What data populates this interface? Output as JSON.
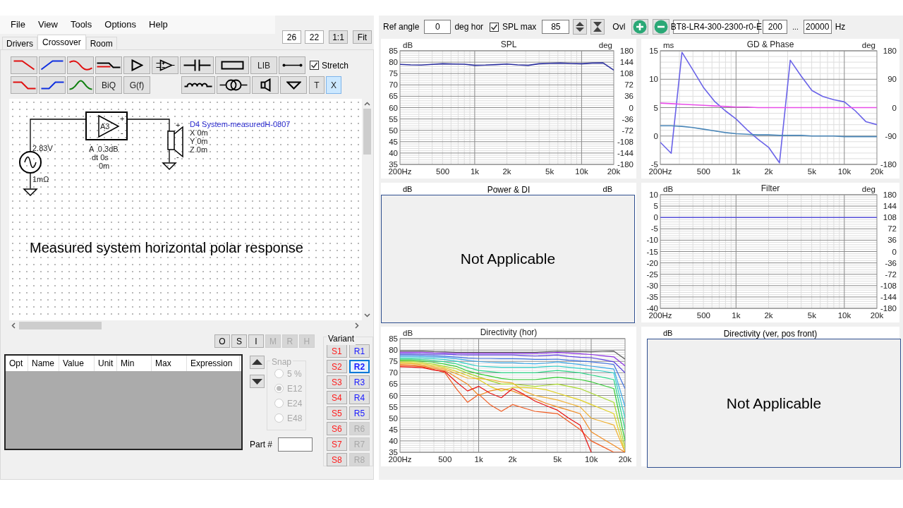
{
  "menu": [
    "File",
    "View",
    "Tools",
    "Options",
    "Help"
  ],
  "zoom_fields": [
    "26",
    "22"
  ],
  "view_buttons": [
    "1:1",
    "Fit"
  ],
  "tabs": [
    {
      "label": "Drivers",
      "selected": false
    },
    {
      "label": "Crossover",
      "selected": true
    },
    {
      "label": "Room",
      "selected": false
    }
  ],
  "toolbar_rows": [
    [
      {
        "kind": "lowpass",
        "selected": false
      },
      {
        "kind": "highpass",
        "selected": false
      },
      {
        "kind": "curve",
        "selected": false
      },
      {
        "kind": "step",
        "selected": false
      },
      {
        "kind": "buffer",
        "selected": false
      },
      {
        "kind": "opamp",
        "selected": false
      },
      {
        "kind": "capacitor",
        "selected": false
      },
      {
        "kind": "resistor",
        "selected": false
      },
      {
        "kind": "text",
        "label": "LIB",
        "selected": false
      },
      {
        "kind": "wire",
        "selected": false
      }
    ],
    [
      {
        "kind": "lowpass2",
        "selected": false
      },
      {
        "kind": "highpass2",
        "selected": false
      },
      {
        "kind": "bandpass",
        "selected": false
      },
      {
        "kind": "text",
        "label": "BiQ",
        "selected": false
      },
      {
        "kind": "text",
        "label": "G(f)",
        "selected": false
      },
      {
        "kind": "inductor",
        "selected": false
      },
      {
        "kind": "transformer",
        "selected": false
      },
      {
        "kind": "speaker",
        "selected": false
      },
      {
        "kind": "ground",
        "selected": false
      },
      {
        "kind": "small",
        "label": "T",
        "selected": false
      },
      {
        "kind": "small",
        "label": "X",
        "selected": true
      }
    ]
  ],
  "stretch": {
    "label": "Stretch",
    "checked": true
  },
  "schematic": {
    "source_voltage": "2.83V",
    "source_resistance": "1mΩ",
    "amp_label": "A3",
    "amp_plus": "+",
    "amp_minus": "-",
    "amp_gain": "A  0.3dB",
    "amp_delay": "dt 0s",
    "amp_offset": "0m",
    "driver_name": "D4 System-measuredH-0807",
    "driver_x": "X 0m",
    "driver_y": "Y 0m",
    "driver_z": "Z 0m",
    "driver_plus": "+",
    "driver_minus": "-"
  },
  "caption": "Measured system horizontal polar response",
  "part_buttons": [
    {
      "label": "O",
      "disabled": false
    },
    {
      "label": "S",
      "disabled": false
    },
    {
      "label": "I",
      "disabled": false
    },
    {
      "label": "M",
      "disabled": true
    },
    {
      "label": "R",
      "disabled": true
    },
    {
      "label": "H",
      "disabled": true
    }
  ],
  "parameter_table": {
    "columns": [
      "Opt",
      "Name",
      "Value",
      "Unit",
      "Min",
      "Max",
      "Expression"
    ]
  },
  "snap": {
    "title": "Snap",
    "disabled": true,
    "options": [
      {
        "label": "5 %",
        "selected": false
      },
      {
        "label": "E12",
        "selected": true
      },
      {
        "label": "E24",
        "selected": false
      },
      {
        "label": "E48",
        "selected": false
      }
    ]
  },
  "part_number": {
    "label": "Part #"
  },
  "variant": {
    "title": "Variant",
    "s": [
      {
        "label": "S1",
        "selected": false,
        "disabled": false
      },
      {
        "label": "S2",
        "selected": false,
        "disabled": false
      },
      {
        "label": "S3",
        "selected": false,
        "disabled": false
      },
      {
        "label": "S4",
        "selected": false,
        "disabled": false
      },
      {
        "label": "S5",
        "selected": false,
        "disabled": false
      },
      {
        "label": "S6",
        "selected": false,
        "disabled": false
      },
      {
        "label": "S7",
        "selected": false,
        "disabled": false
      },
      {
        "label": "S8",
        "selected": false,
        "disabled": false
      }
    ],
    "r": [
      {
        "label": "R1",
        "selected": false,
        "disabled": false
      },
      {
        "label": "R2",
        "selected": true,
        "disabled": false
      },
      {
        "label": "R3",
        "selected": false,
        "disabled": false
      },
      {
        "label": "R4",
        "selected": false,
        "disabled": false
      },
      {
        "label": "R5",
        "selected": false,
        "disabled": false
      },
      {
        "label": "R6",
        "selected": false,
        "disabled": true
      },
      {
        "label": "R7",
        "selected": false,
        "disabled": true
      },
      {
        "label": "R8",
        "selected": false,
        "disabled": true
      }
    ]
  },
  "top_bar": {
    "ref_angle_label": "Ref angle",
    "ref_angle": "0",
    "ref_angle_unit": "deg hor",
    "spl_max": {
      "label": "SPL max",
      "checked": true
    },
    "spl_max_value": "85",
    "overlay_label": "Ovl",
    "overlay_name": "BT8-LR4-300-2300-r0-E",
    "freq_from": "200",
    "range_separator": "...",
    "freq_to": "20000",
    "freq_unit": "Hz"
  },
  "charts": [
    {
      "kind": "chart",
      "chart_data": {
        "type": "line",
        "grid": true,
        "title": "SPL",
        "ylabel": "dB",
        "y2label": "deg",
        "ylim": [
          35,
          85
        ],
        "y2lim": [
          -180,
          180
        ],
        "categories": [
          "200Hz",
          null,
          null,
          null,
          "500",
          null,
          null,
          "1k",
          null,
          null,
          "2k",
          null,
          null,
          null,
          "5k",
          null,
          null,
          "10k",
          null,
          null,
          "20k"
        ],
        "yticks": [
          35,
          40,
          45,
          50,
          55,
          60,
          65,
          70,
          75,
          80,
          85
        ],
        "y2ticks": [
          -180,
          -144,
          -108,
          -72,
          -36,
          0,
          36,
          72,
          108,
          144,
          180
        ],
        "series": [
          {
            "color": "#2b2f9e",
            "values": [
              79,
              78.8,
              78.7,
              79,
              79.3,
              79.2,
              79.1,
              78.6,
              78.7,
              78.9,
              79.2,
              78.8,
              78.6,
              79.3,
              79.5,
              79.6,
              79.4,
              79.3,
              79.6,
              79.7,
              76.5
            ]
          }
        ]
      }
    },
    {
      "kind": "chart",
      "chart_data": {
        "type": "line",
        "grid": true,
        "title": "GD & Phase",
        "ylabel": "ms",
        "y2label": "deg",
        "ylim": [
          -5,
          15
        ],
        "y2lim": [
          -180,
          180
        ],
        "categories": [
          "200Hz",
          null,
          null,
          null,
          "500",
          null,
          null,
          "1k",
          null,
          null,
          "2k",
          null,
          null,
          null,
          "5k",
          null,
          null,
          "10k",
          null,
          null,
          "20k"
        ],
        "yticks": [
          -5,
          0,
          5,
          10,
          15
        ],
        "y2ticks": [
          -180,
          -90,
          0,
          90,
          180
        ],
        "series": [
          {
            "color": "#6a63e8",
            "axis": "y2",
            "values": [
              -110,
              -145,
              175,
              120,
              63,
              20,
              -10,
              -36,
              -70,
              -100,
              -126,
              -175,
              150,
              100,
              54,
              35,
              25,
              18,
              -10,
              -45,
              -54
            ]
          },
          {
            "color": "#e84ee8",
            "values": [
              5.8,
              5.7,
              5.6,
              5.5,
              5.4,
              5.3,
              5.2,
              5.1,
              5.1,
              5,
              5,
              5,
              5,
              5,
              5,
              5,
              5,
              5,
              5,
              5,
              5
            ]
          },
          {
            "color": "#4a86b8",
            "values": [
              1.8,
              1.8,
              1.7,
              1.5,
              1.2,
              0.9,
              0.6,
              0.4,
              0.3,
              0.2,
              0.2,
              0.1,
              0.1,
              0.1,
              0,
              0,
              0,
              -0.1,
              -0.1,
              -0.1,
              -0.1
            ]
          }
        ]
      }
    },
    {
      "kind": "overlay",
      "title": "Power & DI",
      "left_unit": "dB",
      "right_unit": "dB",
      "overlay_text": "Not Applicable"
    },
    {
      "kind": "chart",
      "chart_data": {
        "type": "line",
        "grid": true,
        "title": "Filter",
        "ylabel": "dB",
        "y2label": "deg",
        "ylim": [
          -40,
          10
        ],
        "y2lim": [
          -180,
          180
        ],
        "categories": [
          "200Hz",
          null,
          null,
          null,
          "500",
          null,
          null,
          "1k",
          null,
          null,
          "2k",
          null,
          null,
          null,
          "5k",
          null,
          null,
          "10k",
          null,
          null,
          "20k"
        ],
        "yticks": [
          -40,
          -35,
          -30,
          -25,
          -20,
          -15,
          -10,
          -5,
          0,
          5,
          10
        ],
        "y2ticks": [
          -180,
          -144,
          -108,
          -72,
          -36,
          0,
          36,
          72,
          108,
          144,
          180
        ],
        "series": [
          {
            "color": "#5a55e0",
            "values": [
              0,
              0,
              0,
              0,
              0,
              0,
              0,
              0,
              0,
              0,
              0,
              0,
              0,
              0,
              0,
              0,
              0,
              0,
              0,
              0,
              0
            ]
          }
        ]
      }
    },
    {
      "kind": "chart",
      "chart_data": {
        "type": "line",
        "grid": true,
        "title": "Directivity (hor)",
        "ylabel": "dB",
        "ylim": [
          35,
          85
        ],
        "categories": [
          "200Hz",
          null,
          null,
          null,
          "500",
          null,
          null,
          "1k",
          null,
          null,
          "2k",
          null,
          null,
          null,
          "5k",
          null,
          null,
          "10k",
          null,
          null,
          "20k"
        ],
        "yticks": [
          35,
          40,
          45,
          50,
          55,
          60,
          65,
          70,
          75,
          80,
          85
        ],
        "series": [
          {
            "color": "#555555",
            "values": [
              79.5,
              79.5,
              79.5,
              79.3,
              79.2,
              79,
              79,
              79,
              79,
              79,
              79,
              79,
              79,
              79.2,
              79.4,
              79.3,
              79.3,
              79.2,
              79.4,
              79.5,
              76
            ]
          },
          {
            "color": "#8a2be2",
            "values": [
              79,
              79,
              79,
              78.8,
              78.7,
              78.5,
              78.5,
              78.5,
              78.5,
              78.5,
              78.5,
              78.5,
              78.5,
              78.7,
              78.9,
              78.7,
              78.4,
              78,
              77.5,
              77,
              73
            ]
          },
          {
            "color": "#5b3fe0",
            "values": [
              78.4,
              78.4,
              78.3,
              78.2,
              78.1,
              77.9,
              77.8,
              77.8,
              77.8,
              77.8,
              77.8,
              77.6,
              77.4,
              77.6,
              77.8,
              77.2,
              76.8,
              76.6,
              75.8,
              74.8,
              70
            ]
          },
          {
            "color": "#3c6ee0",
            "values": [
              77.8,
              77.8,
              77.7,
              77.5,
              77.3,
              76.9,
              76.5,
              76.3,
              76.3,
              76.2,
              76.2,
              76.1,
              75.9,
              75.9,
              76,
              75.5,
              75.2,
              74.8,
              74.3,
              73.6,
              63
            ]
          },
          {
            "color": "#3aa8e8",
            "values": [
              77.2,
              77.2,
              77.1,
              76.9,
              76.7,
              76.2,
              75.5,
              74.9,
              74.6,
              74.4,
              74.4,
              74.1,
              73.9,
              74.3,
              74.8,
              74.2,
              73.6,
              72.9,
              72.3,
              71.6,
              55
            ]
          },
          {
            "color": "#30d0c8",
            "values": [
              76.6,
              76.6,
              76.5,
              76.2,
              75.8,
              75.1,
              73.9,
              72.9,
              72.6,
              72.4,
              72.4,
              72.4,
              72.4,
              72.7,
              72.9,
              72.4,
              71.9,
              71.4,
              70.7,
              69.9,
              50
            ]
          },
          {
            "color": "#2ed88a",
            "values": [
              76.1,
              76.1,
              75.8,
              75.3,
              74.8,
              73.9,
              72.4,
              71,
              70.5,
              70,
              70,
              70,
              70,
              70.5,
              71,
              70.5,
              70,
              69,
              68,
              67,
              45
            ]
          },
          {
            "color": "#33cc33",
            "values": [
              75.6,
              75.6,
              75.2,
              74.6,
              73.8,
              72.8,
              70.8,
              69.5,
              68.5,
              67.5,
              67,
              67,
              67,
              67.5,
              68,
              67.5,
              67,
              66,
              64.5,
              63,
              40
            ]
          },
          {
            "color": "#a8d82a",
            "values": [
              75.1,
              75,
              74.6,
              73.8,
              72.8,
              71.8,
              69.8,
              68.2,
              66.5,
              65,
              65,
              64.5,
              64,
              64.5,
              65,
              64,
              63,
              61,
              59,
              57,
              37
            ]
          },
          {
            "color": "#e0d020",
            "values": [
              74.6,
              74.5,
              74,
              73.2,
              72.2,
              70.6,
              68.8,
              67,
              64,
              62,
              63.5,
              63.5,
              63.2,
              62.5,
              61,
              59.5,
              58,
              56,
              54,
              52,
              35
            ]
          },
          {
            "color": "#f0b030",
            "values": [
              74.1,
              74,
              73.5,
              72.6,
              71.6,
              69.6,
              67.6,
              67.5,
              67,
              66,
              65.5,
              62,
              60,
              59,
              58,
              56.5,
              55,
              50,
              48.5,
              47,
              35
            ]
          },
          {
            "color": "#f08a20",
            "values": [
              73.6,
              73.5,
              73,
              72,
              71,
              68,
              65,
              60,
              62,
              63,
              62,
              60,
              58.5,
              56.5,
              55,
              53.5,
              52,
              44,
              41,
              38,
              35
            ]
          },
          {
            "color": "#f05a20",
            "values": [
              73.1,
              73,
              72.6,
              71.5,
              70,
              63,
              57,
              60.5,
              56,
              53,
              56,
              54.5,
              53,
              52.5,
              52,
              48.5,
              45,
              40,
              37.5,
              35,
              35
            ]
          },
          {
            "color": "#e81010",
            "values": [
              72.6,
              72.5,
              72.2,
              71.2,
              70.5,
              66,
              62,
              64,
              61,
              59,
              63,
              60.5,
              57.5,
              55.5,
              53.5,
              50,
              47,
              35,
              null,
              null,
              null
            ]
          }
        ]
      }
    },
    {
      "kind": "overlay",
      "title": "Directivity (ver, pos front)",
      "left_unit": "dB",
      "overlay_text": "Not Applicable"
    }
  ]
}
